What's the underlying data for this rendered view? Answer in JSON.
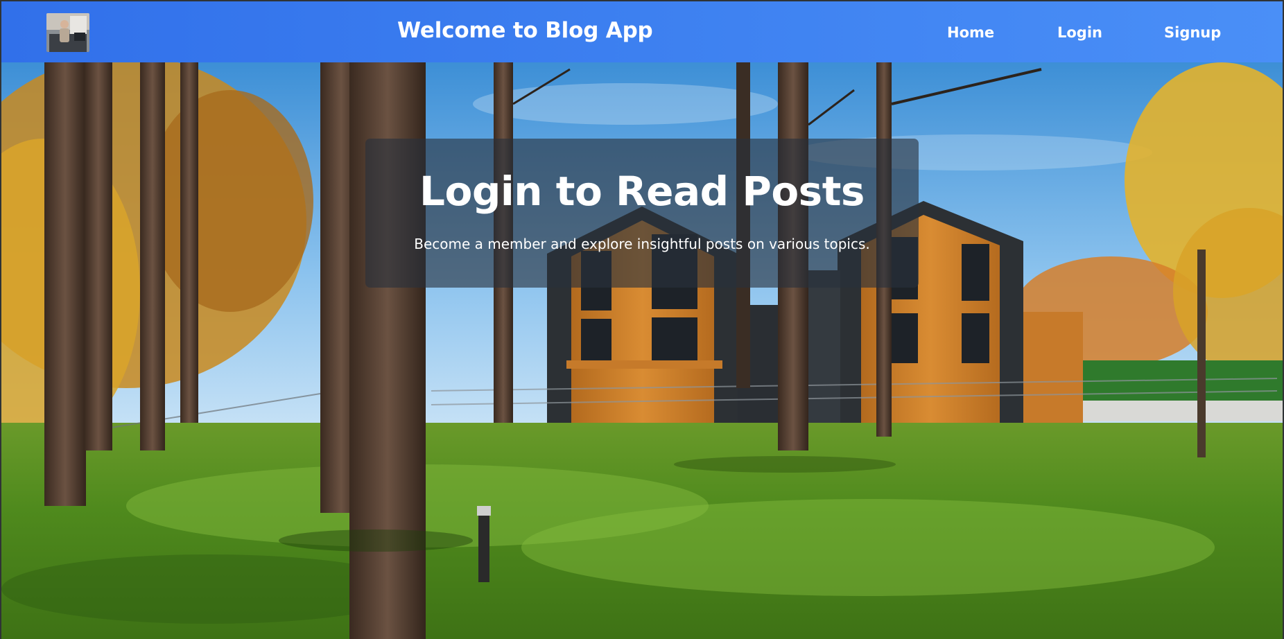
{
  "navbar": {
    "logo_icon": "profile-photo-logo",
    "title": "Welcome to Blog App",
    "links": [
      {
        "label": "Home"
      },
      {
        "label": "Login"
      },
      {
        "label": "Signup"
      }
    ],
    "gradient_colors": [
      "#3170ea",
      "#4a8ff7"
    ]
  },
  "hero": {
    "background_image": "autumn-forest-with-modern-wooden-houses",
    "heading": "Login to Read Posts",
    "subheading": "Become a member and explore insightful posts on various topics.",
    "overlay_color": "#28303c"
  }
}
